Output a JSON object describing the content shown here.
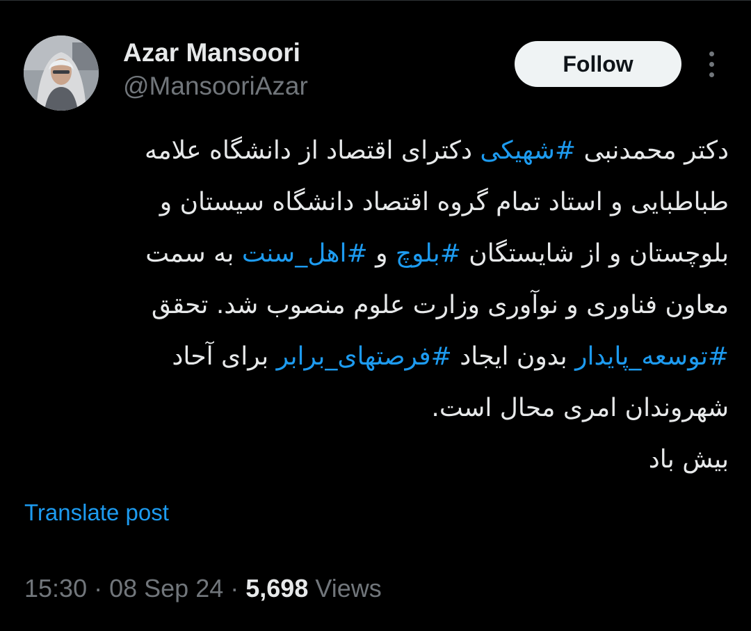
{
  "author": {
    "display_name": "Azar Mansoori",
    "handle": "@MansooriAzar",
    "avatar_icon": "profile-photo"
  },
  "actions": {
    "follow_label": "Follow",
    "more_icon": "more-vertical-icon"
  },
  "tweet": {
    "lines": [
      [
        {
          "text": "دکتر محمدنبی ",
          "hashtag": false
        },
        {
          "text": "#شهیکی",
          "hashtag": true
        },
        {
          "text": " دکترای اقتصاد از دانشگاه علامه",
          "hashtag": false
        }
      ],
      [
        {
          "text": "طباطبایی و استاد تمام گروه اقتصاد دانشگاه سیستان و",
          "hashtag": false
        }
      ],
      [
        {
          "text": "بلوچستان و از شایستگان ",
          "hashtag": false
        },
        {
          "text": "#بلوچ",
          "hashtag": true
        },
        {
          "text": " و ",
          "hashtag": false
        },
        {
          "text": "#اهل_سنت",
          "hashtag": true
        },
        {
          "text": " به سمت",
          "hashtag": false
        }
      ],
      [
        {
          "text": "معاون فناوری و نوآوری وزارت علوم منصوب شد. تحقق",
          "hashtag": false
        }
      ],
      [
        {
          "text": "#توسعه_پایدار",
          "hashtag": true
        },
        {
          "text": " بدون ایجاد ",
          "hashtag": false
        },
        {
          "text": "#فرصتهای_برابر",
          "hashtag": true
        },
        {
          "text": " برای آحاد",
          "hashtag": false
        }
      ],
      [
        {
          "text": "شهروندان امری محال است.",
          "hashtag": false
        }
      ],
      [
        {
          "text": "بیش باد",
          "hashtag": false
        }
      ]
    ]
  },
  "translate_label": "Translate post",
  "meta": {
    "time": "15:30",
    "separator": "·",
    "date": "08 Sep 24",
    "views_count": "5,698",
    "views_label": "Views"
  },
  "colors": {
    "background": "#000000",
    "text_primary": "#e7e9ea",
    "text_secondary": "#71767b",
    "link_blue": "#1d9bf0",
    "follow_button_bg": "#eff3f4",
    "follow_button_text": "#0f1419"
  }
}
